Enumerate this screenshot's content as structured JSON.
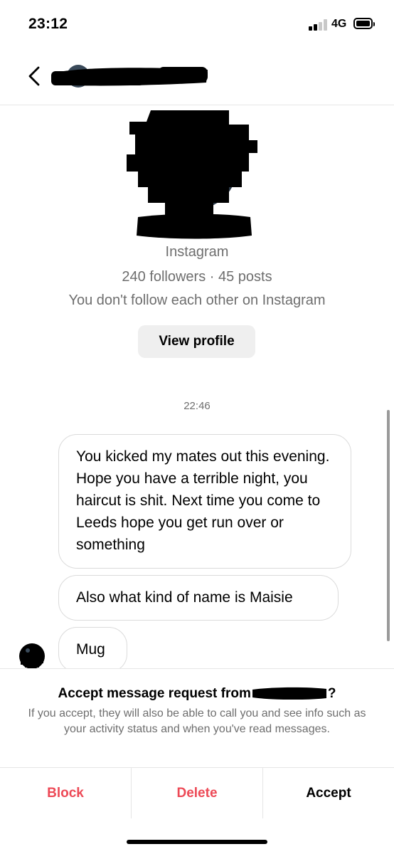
{
  "status_bar": {
    "time": "23:12",
    "network": "4G",
    "signal_bars_active": 2,
    "signal_bars_total": 4
  },
  "header": {
    "back_icon": "chevron-left-icon",
    "name": "[redacted]"
  },
  "profile": {
    "platform": "Instagram",
    "stats": "240 followers · 45 posts",
    "follow_note": "You don't follow each other on Instagram",
    "view_profile_label": "View profile"
  },
  "conversation": {
    "timestamp": "22:46",
    "messages": [
      {
        "text": "You kicked my mates out this evening. Hope you have a terrible night, you haircut is shit. Next time you come to Leeds hope you get run over or something"
      },
      {
        "text": "Also what kind of name is Maisie"
      },
      {
        "text": "Mug"
      }
    ]
  },
  "request_panel": {
    "title_prefix": "Accept message request from",
    "title_suffix": "?",
    "description": "If you accept, they will also be able to call you and see info such as your activity status and when you've read messages.",
    "actions": {
      "block": "Block",
      "delete": "Delete",
      "accept": "Accept"
    }
  },
  "colors": {
    "destructive": "#ed4956",
    "secondary_text": "#6e6e6e",
    "bubble_border": "#dbdbdb",
    "button_bg": "#efefef"
  }
}
